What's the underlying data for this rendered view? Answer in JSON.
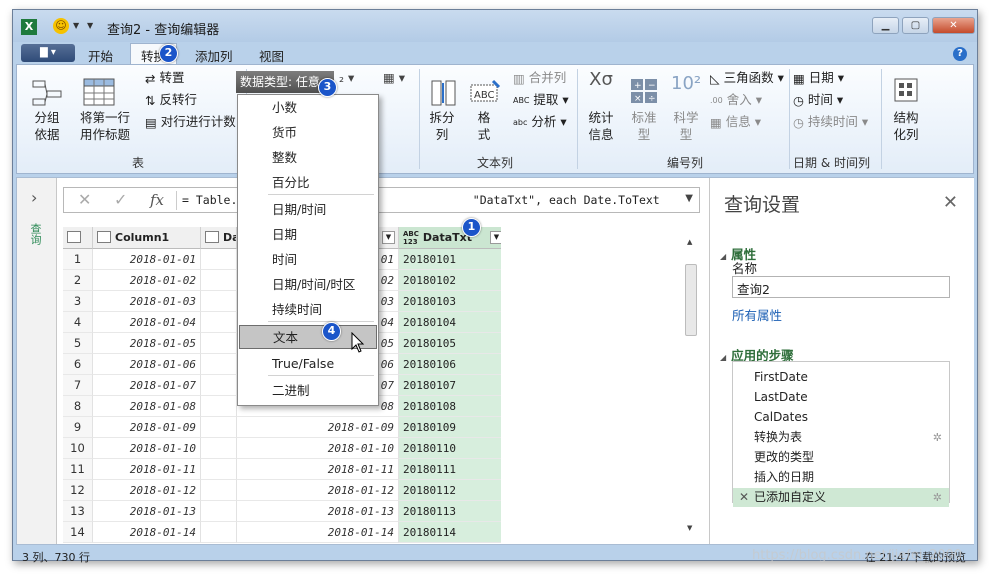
{
  "title": "查询2 - 查询编辑器",
  "menu": {
    "file_label": "▇ ▾",
    "tabs": [
      "开始",
      "转换",
      "添加列",
      "视图"
    ],
    "active_tab": "转换",
    "help": "?"
  },
  "ribbon": {
    "table_group": {
      "label": "表",
      "group_by": "分组\n依据",
      "use_first_row": "将第一行\n用作标题",
      "transpose": "转置",
      "reverse_rows": "反转行",
      "count_rows": "对行进行计数"
    },
    "data_type_button": "数据类型: 任意",
    "text_column_group": {
      "label": "文本列",
      "split_column": "拆分\n列",
      "format": "格\n式",
      "merge_columns": "合并列",
      "extract": "提取",
      "parse": "分析"
    },
    "number_column_group": {
      "label": "编号列",
      "statistics": "统计\n信息",
      "standard": "标准\n型",
      "scientific": "科学\n型",
      "trigonometry": "三角函数",
      "rounding": "舍入",
      "information": "信息"
    },
    "datetime_group": {
      "label": "日期 & 时间列",
      "date": "日期",
      "time": "时间",
      "duration": "持续时间"
    },
    "structured_column": "结构\n化列"
  },
  "formula_bar": {
    "formula": "= Table.                                  \"DataTxt\", each Date.ToText"
  },
  "grid": {
    "headers": [
      "Column1",
      "Da",
      "",
      "DataTxt"
    ],
    "rows": [
      {
        "n": "1",
        "c1": "2018-01-01",
        "c2": "",
        "c3": "01",
        "txt": "20180101"
      },
      {
        "n": "2",
        "c1": "2018-01-02",
        "c2": "",
        "c3": "02",
        "txt": "20180102"
      },
      {
        "n": "3",
        "c1": "2018-01-03",
        "c2": "",
        "c3": "03",
        "txt": "20180103"
      },
      {
        "n": "4",
        "c1": "2018-01-04",
        "c2": "",
        "c3": "04",
        "txt": "20180104"
      },
      {
        "n": "5",
        "c1": "2018-01-05",
        "c2": "",
        "c3": "05",
        "txt": "20180105"
      },
      {
        "n": "6",
        "c1": "2018-01-06",
        "c2": "",
        "c3": "06",
        "txt": "20180106"
      },
      {
        "n": "7",
        "c1": "2018-01-07",
        "c2": "",
        "c3": "07",
        "txt": "20180107"
      },
      {
        "n": "8",
        "c1": "2018-01-08",
        "c2": "",
        "c3": "08",
        "txt": "20180108"
      },
      {
        "n": "9",
        "c1": "2018-01-09",
        "c2": "",
        "c3": "2018-01-09",
        "txt": "20180109"
      },
      {
        "n": "10",
        "c1": "2018-01-10",
        "c2": "",
        "c3": "2018-01-10",
        "txt": "20180110"
      },
      {
        "n": "11",
        "c1": "2018-01-11",
        "c2": "",
        "c3": "2018-01-11",
        "txt": "20180111"
      },
      {
        "n": "12",
        "c1": "2018-01-12",
        "c2": "",
        "c3": "2018-01-12",
        "txt": "20180112"
      },
      {
        "n": "13",
        "c1": "2018-01-13",
        "c2": "",
        "c3": "2018-01-13",
        "txt": "20180113"
      },
      {
        "n": "14",
        "c1": "2018-01-14",
        "c2": "",
        "c3": "2018-01-14",
        "txt": "20180114"
      }
    ]
  },
  "nav_pane": {
    "label": "查询"
  },
  "dropdown": {
    "items": [
      "小数",
      "货币",
      "整数",
      "百分比",
      "日期/时间",
      "日期",
      "时间",
      "日期/时间/时区",
      "持续时间",
      "文本",
      "True/False",
      "二进制"
    ],
    "highlighted": "文本"
  },
  "badges": [
    "1",
    "2",
    "3",
    "4"
  ],
  "settings": {
    "title": "查询设置",
    "properties_label": "属性",
    "name_label": "名称",
    "name_value": "查询2",
    "all_properties": "所有属性",
    "steps_label": "应用的步骤",
    "steps": [
      "FirstDate",
      "LastDate",
      "CalDates",
      "转换为表",
      "更改的类型",
      "插入的日期",
      "已添加自定义"
    ]
  },
  "status": {
    "left": "3 列、730 行",
    "right": "在 21:47下载的预览"
  },
  "watermark": "https://blog.csdn.net/jiefei_2000"
}
